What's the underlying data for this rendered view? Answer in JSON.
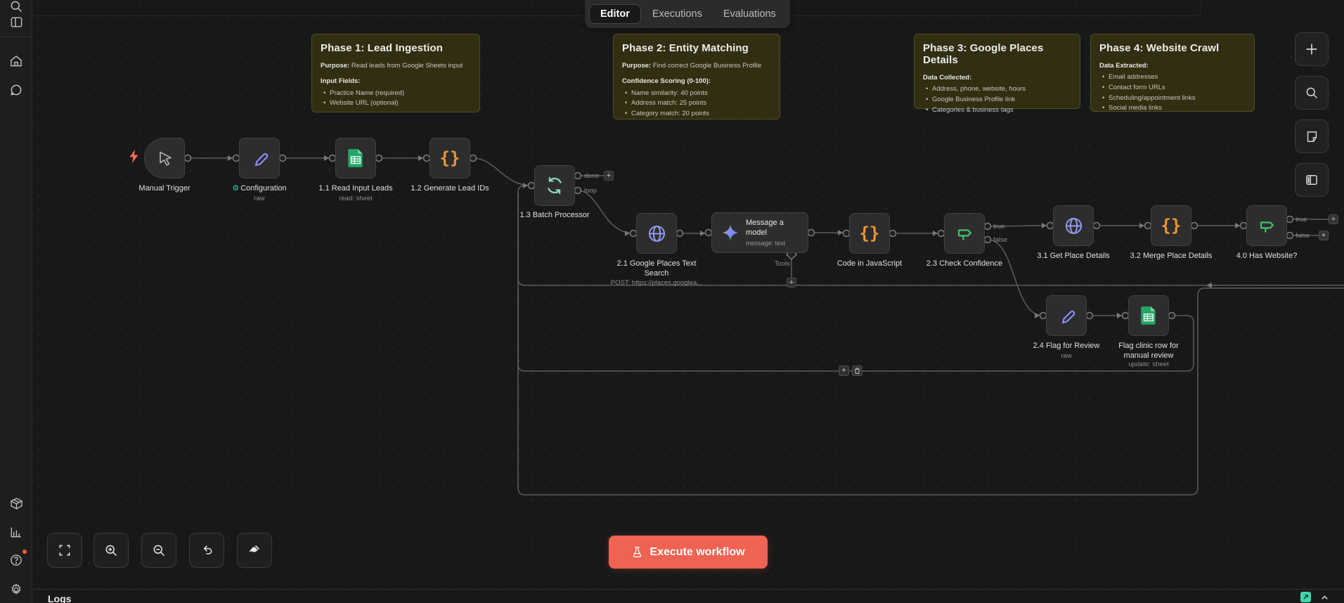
{
  "tabs": {
    "items": [
      "Editor",
      "Executions",
      "Evaluations"
    ],
    "active": "Editor"
  },
  "notes": [
    {
      "title": "Phase 1: Lead Ingestion",
      "purpose_label": "Purpose:",
      "purpose": " Read leads from Google Sheets input",
      "section_label": "Input Fields:",
      "bullets": [
        "Practice Name (required)",
        "Website URL (optional)"
      ]
    },
    {
      "title": "Phase 2: Entity Matching",
      "purpose_label": "Purpose:",
      "purpose": " Find correct Google Business Profile",
      "section_label": "Confidence Scoring (0-100):",
      "bullets": [
        "Name similarity: 40 points",
        "Address match: 25 points",
        "Category match: 20 points"
      ]
    },
    {
      "title": "Phase 3: Google Places Details",
      "section_label": "Data Collected:",
      "bullets": [
        "Address, phone, website, hours",
        "Google Business Profile link",
        "Categories & business tags"
      ]
    },
    {
      "title": "Phase 4: Website Crawl",
      "section_label": "Data Extracted:",
      "bullets": [
        "Email addresses",
        "Contact form URLs",
        "Scheduling/appointment links",
        "Social media links"
      ]
    }
  ],
  "nodes": [
    {
      "label": "Manual Trigger",
      "icon": "cursor-icon"
    },
    {
      "label": "Configuration",
      "sublabel": "raw",
      "icon": "pencil-icon",
      "badge": "gear"
    },
    {
      "label": "1.1 Read Input Leads",
      "sublabel": "read: sheet",
      "icon": "google-sheets-icon"
    },
    {
      "label": "1.2 Generate Lead IDs",
      "icon": "code-braces-icon"
    },
    {
      "label": "1.3 Batch Processor",
      "icon": "loop-icon"
    },
    {
      "label": "2.1 Google Places Text Search",
      "sublabel": "POST: https://places.googlea...",
      "icon": "globe-icon"
    },
    {
      "label": "Message a model",
      "sublabel": "message: text",
      "icon": "gemini-star-icon"
    },
    {
      "label": "Code in JavaScript",
      "icon": "code-braces-icon"
    },
    {
      "label": "2.3 Check Confidence",
      "icon": "if-signpost-icon"
    },
    {
      "label": "3.1 Get Place Details",
      "icon": "globe-icon"
    },
    {
      "label": "3.2 Merge Place Details",
      "icon": "code-braces-icon"
    },
    {
      "label": "4.0 Has Website?",
      "icon": "if-signpost-icon"
    },
    {
      "label": "2.4 Flag for Review",
      "sublabel": "raw",
      "icon": "pencil-icon"
    },
    {
      "label": "Flag clinic row for manual review",
      "sublabel": "update: sheet",
      "icon": "google-sheets-icon"
    }
  ],
  "ports": {
    "done": "done",
    "loop": "loop",
    "true": "true",
    "false": "false",
    "tools": "Tools"
  },
  "execute": {
    "label": "Execute workflow"
  },
  "logs": {
    "title": "Logs"
  },
  "sidebar_icons": [
    "search-icon",
    "panel-toggle-icon",
    "home-icon",
    "chat-icon",
    "package-icon",
    "insights-chart-icon",
    "help-icon",
    "settings-gear-icon"
  ],
  "canvas_buttons": [
    "add-node",
    "search-canvas",
    "sticky-note",
    "split-panel"
  ],
  "zoom_controls": [
    "fit-view",
    "zoom-in",
    "zoom-out",
    "undo",
    "tidy-up"
  ],
  "colors": {
    "execute_button": "#ee6352",
    "sticky_bg": "#322e11",
    "node_bg": "#2d2d2d",
    "code_icon": "#f09637",
    "sheets_icon": "#23a566",
    "globe_icon": "#8e99f3",
    "pencil_icon": "#8f8ffc",
    "if_icon": "#41c368",
    "loop_icon": "#8bdac6",
    "bolt": "#ff6d5a",
    "logs_popout": "#3dd6ad",
    "gear_badge": "#3ecfae"
  }
}
